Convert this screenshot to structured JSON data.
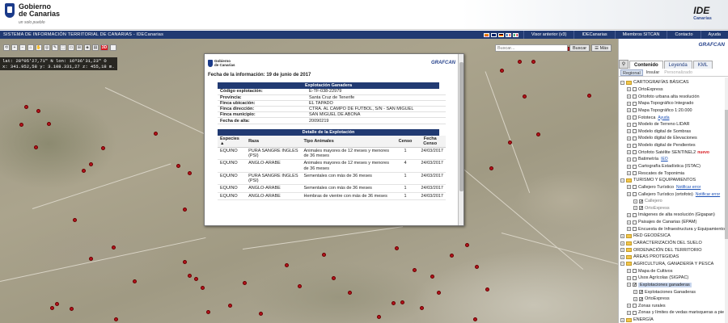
{
  "header": {
    "org_line1": "Gobierno",
    "org_line2": "de Canarias",
    "slogan": "un solo pueblo",
    "ide_logo": "IDE",
    "ide_sub": "Canarias"
  },
  "navbar": {
    "title": "SISTEMA DE INFORMACIÓN TERRITORIAL DE CANARIAS - IDECanarias",
    "links": [
      "Visor anterior (v3)",
      "IDECanarias",
      "Miembros SITCAN",
      "Contacto",
      "Ayuda"
    ],
    "flag_colors": [
      "#c60b1e",
      "#012169",
      "#000000",
      "#0055a4",
      "#009246"
    ]
  },
  "toolbar": {
    "buttons": [
      "⟲",
      "+",
      "−",
      "⌂",
      "✋",
      "◎",
      "✎",
      "⬚",
      "▭",
      "⊞",
      "◈",
      "▤"
    ],
    "three_d_label": "3D"
  },
  "search": {
    "placeholder": "Buscar...",
    "button": "Buscar",
    "more": "Más"
  },
  "coords": {
    "line1": "lat: 28º05'27,71\" N  lon: 16º36'31,23\" O",
    "line2": "x: 341.952,58  y: 3.108.331,27  z: 455,18 m."
  },
  "popup": {
    "gov_line1": "Gobierno",
    "gov_line2": "de Canarias",
    "grafcan": "GRAFCAN",
    "date": "Fecha de la información: 19 de junio de 2017",
    "section1": "Explotación Ganadera",
    "fields": [
      {
        "k": "Código explotación:",
        "v": "E-TF-038-22979"
      },
      {
        "k": "Provincia:",
        "v": "Santa Cruz de Tenerife"
      },
      {
        "k": "Finca ubicación:",
        "v": "EL TAPADO"
      },
      {
        "k": "Finca dirección:",
        "v": "CTRA. AL CAMPO DE FUTBOL, S/N - SAN MIGUEL"
      },
      {
        "k": "Finca municipio:",
        "v": "SAN MIGUEL DE ABONA"
      },
      {
        "k": "Fecha de alta:",
        "v": "20090219"
      }
    ],
    "section2": "Detalle de la Explotación",
    "columns": [
      "Especies ▲",
      "Raza",
      "Tipo Animales",
      "Censo",
      "Fecha Censo"
    ],
    "rows": [
      [
        "EQUINO",
        "PURA SANGRE INGLES (PSI)",
        "Animales mayores de 12 meses y menores de 36 meses",
        "1",
        "24/03/2017"
      ],
      [
        "EQUINO",
        "ANGLO-ARABE",
        "Animales mayores de 12 meses y menores de 36 meses",
        "4",
        "24/03/2017"
      ],
      [
        "EQUINO",
        "PURA SANGRE INGLES (PSI)",
        "Sementales con más de 36 meses",
        "1",
        "24/03/2017"
      ],
      [
        "EQUINO",
        "ANGLO-ARABE",
        "Sementales con más de 36 meses",
        "1",
        "24/03/2017"
      ],
      [
        "EQUINO",
        "ANGLO-ARABE",
        "Hembras de vientre con más de 36 meses",
        "1",
        "24/03/2017"
      ]
    ]
  },
  "panel": {
    "grafcan": "GRAFCAN",
    "tabs": [
      "Contenido",
      "Leyenda",
      "KML"
    ],
    "subtabs": [
      "Regional",
      "Insular",
      "Personalizado"
    ],
    "nodes": [
      {
        "t": "cat",
        "label": "CARTOGRAFÍAS BÁSICAS",
        "d": 0,
        "exp": "−"
      },
      {
        "t": "layer",
        "label": "OrtoExpress",
        "d": 1
      },
      {
        "t": "layer",
        "label": "Ortofoto urbana alta resolución",
        "d": 1
      },
      {
        "t": "layer",
        "label": "Mapa Topográfico Integrado",
        "d": 1
      },
      {
        "t": "layer",
        "label": "Mapa Topográfico 1:20.000",
        "d": 1
      },
      {
        "t": "layer",
        "label": "Fototeca",
        "d": 1,
        "extra": "Ayuda"
      },
      {
        "t": "layer",
        "label": "Modelo de Terreno LIDAR",
        "d": 1
      },
      {
        "t": "layer",
        "label": "Modelo digital de Sombras",
        "d": 1
      },
      {
        "t": "layer",
        "label": "Modelo digital de Elevaciones",
        "d": 1
      },
      {
        "t": "layer",
        "label": "Modelo digital de Pendientes",
        "d": 1
      },
      {
        "t": "layer",
        "label": "Ortofoto Satélite SENTINEL2",
        "d": 1,
        "nuevo": "nuevo"
      },
      {
        "t": "layer",
        "label": "Batimetría",
        "d": 1,
        "extra": "IEO"
      },
      {
        "t": "layer",
        "label": "Cartografía Estadística (ISTAC)",
        "d": 1
      },
      {
        "t": "layer",
        "label": "Rescates de Toponimia",
        "d": 1
      },
      {
        "t": "cat",
        "label": "TURISMO Y EQUIPAMIENTOS",
        "d": 0,
        "exp": "−"
      },
      {
        "t": "layer",
        "label": "Callejero Turístico",
        "d": 1,
        "extra": "Notificar error"
      },
      {
        "t": "layer",
        "label": "Callejero Turístico (ortofoto)",
        "d": 1,
        "extra": "Notificar error"
      },
      {
        "t": "layer",
        "label": "Callejero",
        "d": 2,
        "dim": true,
        "chk": true
      },
      {
        "t": "layer",
        "label": "OrtoExpress",
        "d": 2,
        "dim": true,
        "chk": true
      },
      {
        "t": "layer",
        "label": "Imágenes de alta resolución (Gigapan)",
        "d": 1
      },
      {
        "t": "layer",
        "label": "Paisajes de Canarias (EPAM)",
        "d": 1
      },
      {
        "t": "layer",
        "label": "Encuesta de Infraestructura y Equipamientos",
        "d": 1
      },
      {
        "t": "cat",
        "label": "RED GEODÉSICA",
        "d": 0,
        "exp": "+"
      },
      {
        "t": "cat",
        "label": "CARACTERIZACIÓN DEL SUELO",
        "d": 0,
        "exp": "+"
      },
      {
        "t": "cat",
        "label": "ORDENACIÓN DEL TERRITORIO",
        "d": 0,
        "exp": "+"
      },
      {
        "t": "cat",
        "label": "ÁREAS PROTEGIDAS",
        "d": 0,
        "exp": "+"
      },
      {
        "t": "cat",
        "label": "AGRICULTURA, GANADERÍA Y PESCA",
        "d": 0,
        "exp": "−"
      },
      {
        "t": "layer",
        "label": "Mapa de Cultivos",
        "d": 1
      },
      {
        "t": "layer",
        "label": "Usos Agrícolas (SIGPAC)",
        "d": 1
      },
      {
        "t": "layer",
        "label": "Explotaciones ganaderas",
        "d": 1,
        "sel": true,
        "chk": true
      },
      {
        "t": "layer",
        "label": "Explotaciones Ganaderas",
        "d": 2,
        "chk": true
      },
      {
        "t": "layer",
        "label": "OrtoExpress",
        "d": 2,
        "chk": true
      },
      {
        "t": "layer",
        "label": "Zonas rurales",
        "d": 1
      },
      {
        "t": "layer",
        "label": "Zonas y límites de vedas marisqueras a pie",
        "d": 1
      },
      {
        "t": "cat",
        "label": "ENERGÍA",
        "d": 0,
        "exp": "+"
      }
    ]
  }
}
